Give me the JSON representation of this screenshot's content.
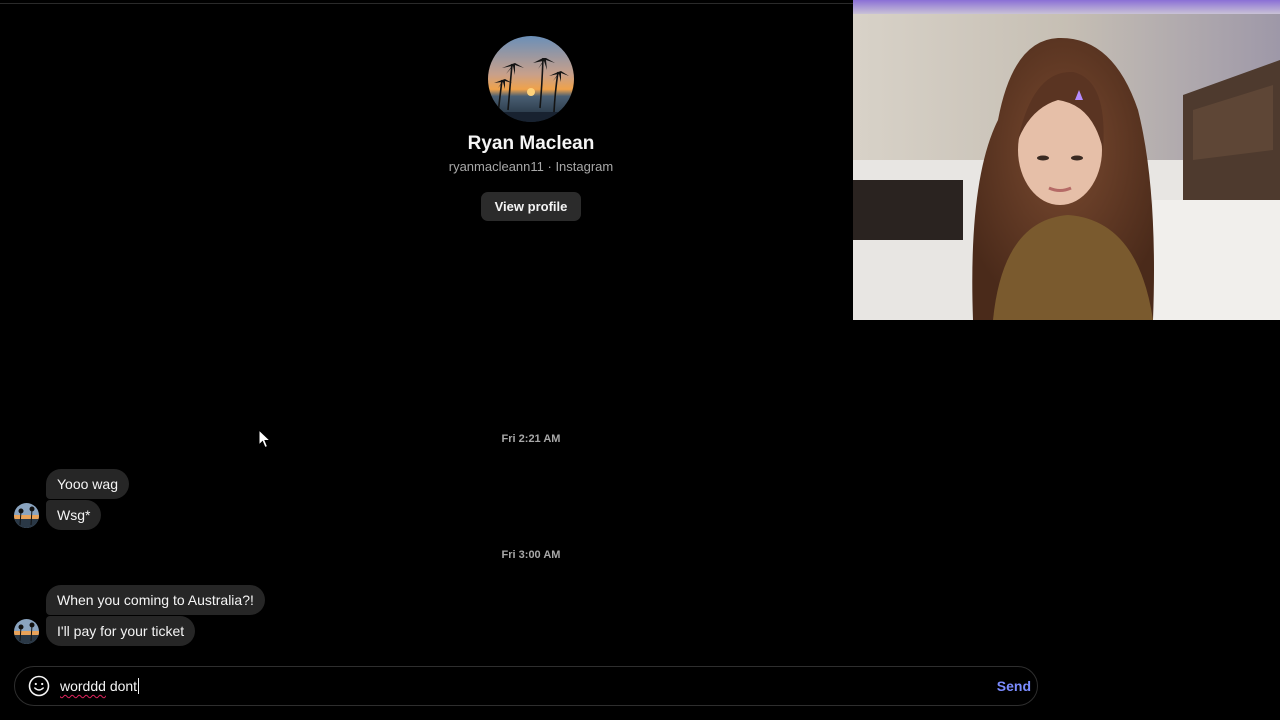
{
  "profile": {
    "name": "Ryan Maclean",
    "subtitle": "ryanmacleann11 · Instagram",
    "view_profile_label": "View profile"
  },
  "thread": {
    "groups": [
      {
        "timestamp": "Fri 2:21 AM",
        "messages": [
          "Yooo wag",
          "Wsg*"
        ]
      },
      {
        "timestamp": "Fri 3:00 AM",
        "messages": [
          "When you coming to Australia?!",
          "I'll pay for your ticket"
        ]
      }
    ]
  },
  "composer": {
    "draft_word_1": "worddd",
    "draft_word_2": "dont",
    "send_label": "Send",
    "emoji_icon": "emoji-icon"
  },
  "colors": {
    "background": "#000000",
    "bubble": "#262626",
    "send_accent": "#7b8cff",
    "button_bg": "#2b2b2b",
    "muted_text": "#a8a8a8",
    "spellcheck": "#e0245e"
  }
}
